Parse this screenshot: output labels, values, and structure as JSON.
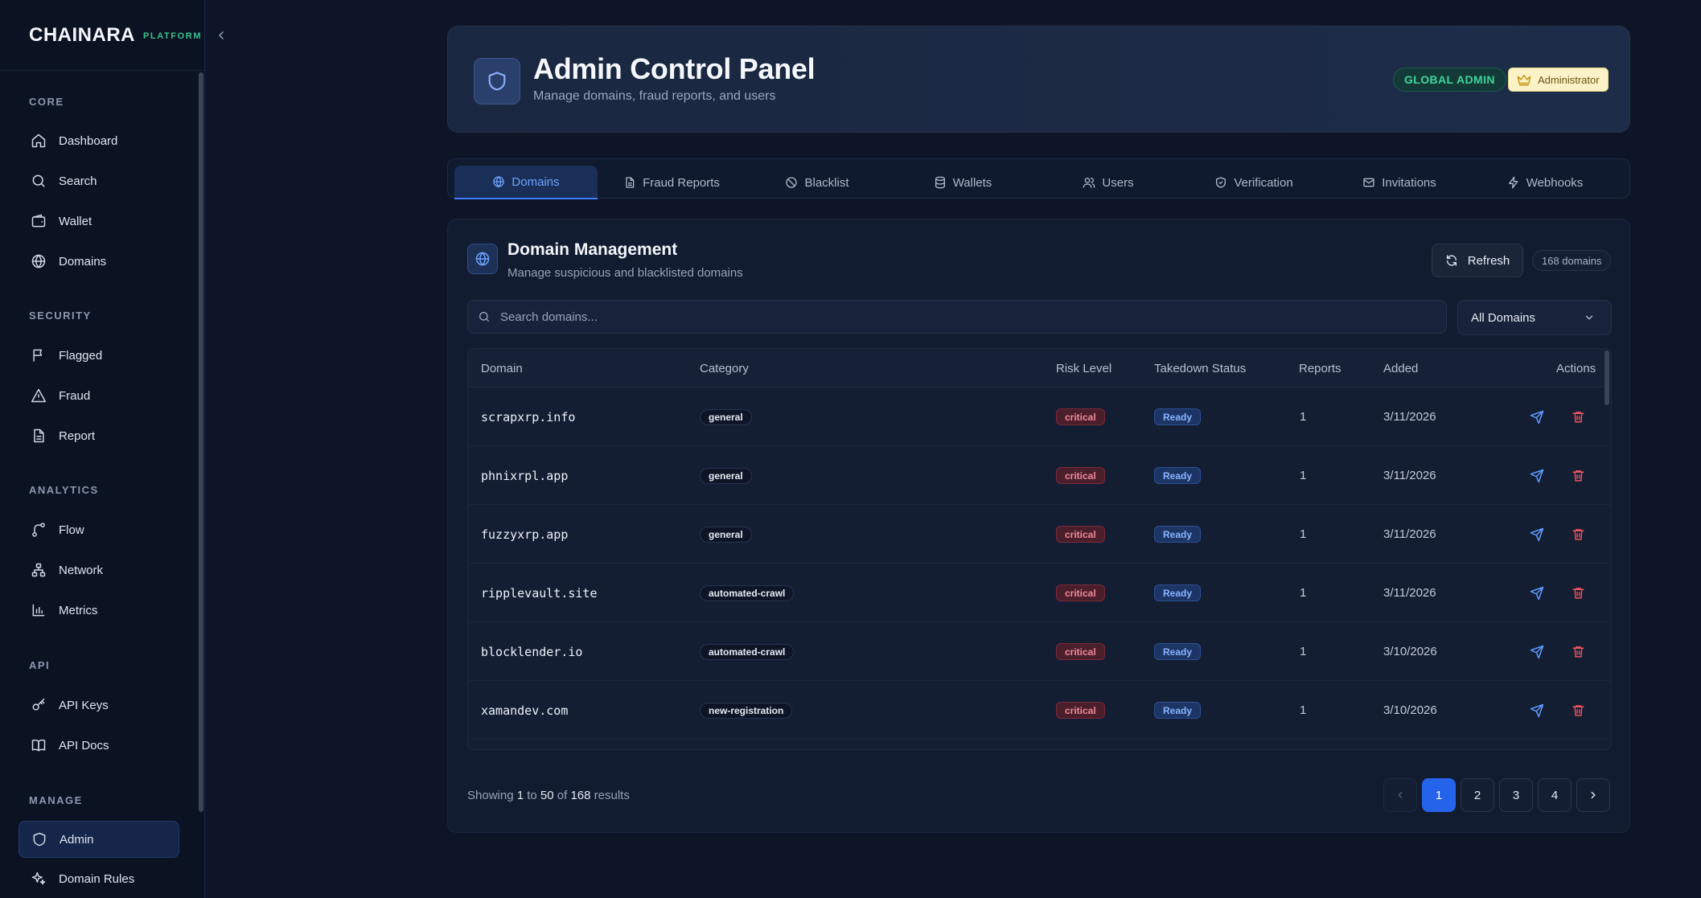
{
  "brand": {
    "name": "CHAINARA",
    "tag": "PLATFORM"
  },
  "sidebar": {
    "sections": [
      {
        "title": "CORE",
        "items": [
          {
            "label": "Dashboard",
            "icon": "home-icon"
          },
          {
            "label": "Search",
            "icon": "search-icon"
          },
          {
            "label": "Wallet",
            "icon": "wallet-icon"
          },
          {
            "label": "Domains",
            "icon": "globe-icon"
          }
        ]
      },
      {
        "title": "SECURITY",
        "items": [
          {
            "label": "Flagged",
            "icon": "flag-icon"
          },
          {
            "label": "Fraud",
            "icon": "warning-icon"
          },
          {
            "label": "Report",
            "icon": "document-icon"
          }
        ]
      },
      {
        "title": "ANALYTICS",
        "items": [
          {
            "label": "Flow",
            "icon": "flow-icon"
          },
          {
            "label": "Network",
            "icon": "network-icon"
          },
          {
            "label": "Metrics",
            "icon": "bar-chart-icon"
          }
        ]
      },
      {
        "title": "API",
        "items": [
          {
            "label": "API Keys",
            "icon": "key-icon"
          },
          {
            "label": "API Docs",
            "icon": "book-icon"
          }
        ]
      },
      {
        "title": "MANAGE",
        "items": [
          {
            "label": "Admin",
            "icon": "shield-icon",
            "active": true
          },
          {
            "label": "Domain Rules",
            "icon": "sparkle-icon"
          }
        ]
      }
    ]
  },
  "header": {
    "title": "Admin Control Panel",
    "subtitle": "Manage domains, fraud reports, and users",
    "badge_global": "GLOBAL ADMIN",
    "badge_role": "Administrator"
  },
  "tabs": [
    {
      "label": "Domains",
      "icon": "globe-icon",
      "active": true
    },
    {
      "label": "Fraud Reports",
      "icon": "document-icon"
    },
    {
      "label": "Blacklist",
      "icon": "ban-icon"
    },
    {
      "label": "Wallets",
      "icon": "database-icon"
    },
    {
      "label": "Users",
      "icon": "users-icon"
    },
    {
      "label": "Verification",
      "icon": "shield-check-icon"
    },
    {
      "label": "Invitations",
      "icon": "mail-icon"
    },
    {
      "label": "Webhooks",
      "icon": "lightning-icon"
    }
  ],
  "domain_card": {
    "title": "Domain Management",
    "subtitle": "Manage suspicious and blacklisted domains",
    "refresh_label": "Refresh",
    "count_label": "168 domains",
    "search_placeholder": "Search domains...",
    "filter_value": "All Domains",
    "columns": {
      "domain": "Domain",
      "category": "Category",
      "risk": "Risk Level",
      "status": "Takedown Status",
      "reports": "Reports",
      "added": "Added",
      "actions": "Actions"
    },
    "rows": [
      {
        "domain": "scrapxrp.info",
        "category": "general",
        "risk": "critical",
        "status": "Ready",
        "reports": "1",
        "added": "3/11/2026"
      },
      {
        "domain": "phnixrpl.app",
        "category": "general",
        "risk": "critical",
        "status": "Ready",
        "reports": "1",
        "added": "3/11/2026"
      },
      {
        "domain": "fuzzyxrp.app",
        "category": "general",
        "risk": "critical",
        "status": "Ready",
        "reports": "1",
        "added": "3/11/2026"
      },
      {
        "domain": "ripplevault.site",
        "category": "automated-crawl",
        "risk": "critical",
        "status": "Ready",
        "reports": "1",
        "added": "3/11/2026"
      },
      {
        "domain": "blocklender.io",
        "category": "automated-crawl",
        "risk": "critical",
        "status": "Ready",
        "reports": "1",
        "added": "3/10/2026"
      },
      {
        "domain": "xamandev.com",
        "category": "new-registration",
        "risk": "critical",
        "status": "Ready",
        "reports": "1",
        "added": "3/10/2026"
      }
    ],
    "footer": {
      "showing_prefix": "Showing",
      "from": "1",
      "to_word": "to",
      "to": "50",
      "of_word": "of",
      "total": "168",
      "results_word": "results"
    },
    "pages": [
      "1",
      "2",
      "3",
      "4"
    ],
    "current_page": "1"
  },
  "colors": {
    "accent": "#2563eb",
    "critical": "#f08a9a",
    "ready": "#8ab4ff",
    "global_admin": "#3fd4a0"
  }
}
